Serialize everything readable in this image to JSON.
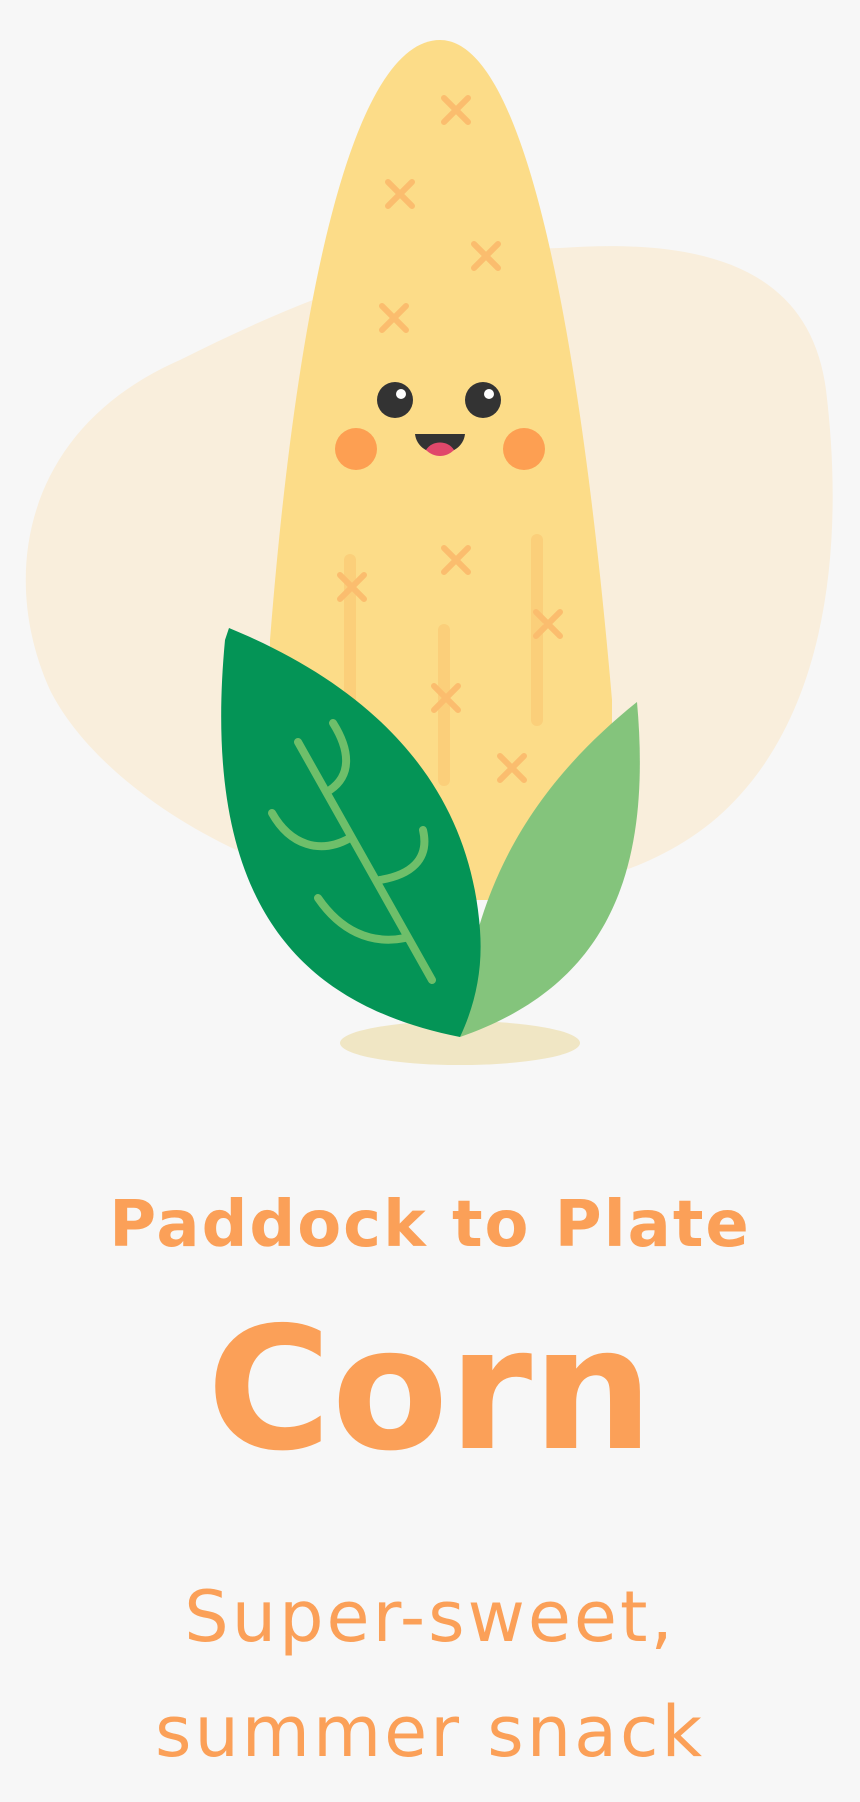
{
  "illustration": {
    "subject": "corn-character",
    "colors": {
      "background_blob": "#f9eedc",
      "cob": "#fcdc88",
      "cob_mark": "#fbbd6e",
      "eye": "#333333",
      "cheek": "#fd9f52",
      "mouth": "#333333",
      "tongue": "#e0486a",
      "leaf_dark": "#049456",
      "leaf_light": "#84c47c",
      "leaf_vein": "#6ebf6a",
      "shadow": "#f0e6c4"
    }
  },
  "hero": {
    "subtitle": "Paddock to Plate",
    "title": "Corn",
    "tagline_line1": "Super-sweet,",
    "tagline_line2": "summer snack"
  },
  "theme": {
    "page_background": "#f7f7f7",
    "text_accent": "#fba058"
  }
}
